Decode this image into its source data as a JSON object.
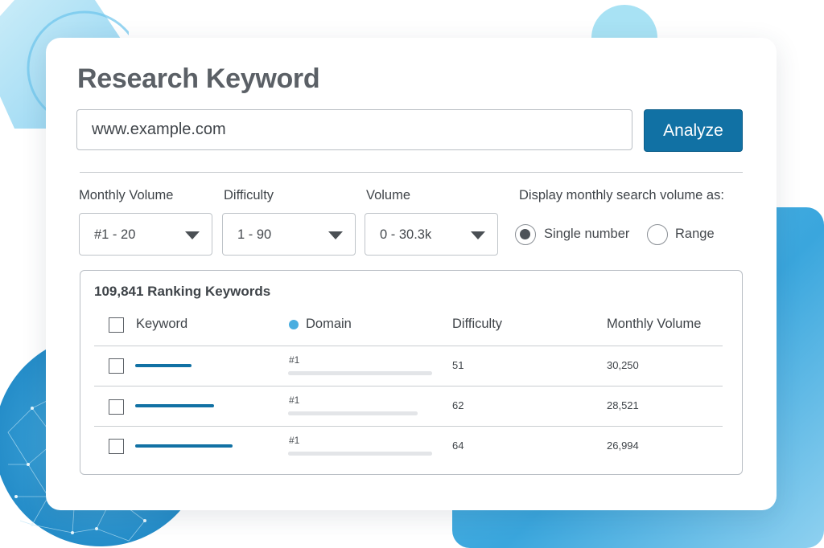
{
  "header": {
    "title": "Research Keyword"
  },
  "search": {
    "value": "www.example.com",
    "analyze_label": "Analyze"
  },
  "filters": [
    {
      "label": "Monthly Volume",
      "value": "#1 - 20"
    },
    {
      "label": "Difficulty",
      "value": "1 - 90"
    },
    {
      "label": "Volume",
      "value": "0 - 30.3k"
    }
  ],
  "display": {
    "label": "Display monthly search volume as:",
    "options": [
      {
        "label": "Single number",
        "selected": true
      },
      {
        "label": "Range",
        "selected": false
      }
    ]
  },
  "results": {
    "title": "109,841 Ranking Keywords",
    "columns": [
      "Keyword",
      "Domain",
      "Difficulty",
      "Monthly Volume"
    ],
    "rows": [
      {
        "rank": "#1",
        "difficulty": "51",
        "volume": "30,250"
      },
      {
        "rank": "#1",
        "difficulty": "62",
        "volume": "28,521"
      },
      {
        "rank": "#1",
        "difficulty": "64",
        "volume": "26,994"
      }
    ]
  },
  "colors": {
    "accent": "#1171a4",
    "domain_dot": "#4aaee0",
    "decor_light": "#a8e2f4",
    "decor_mid": "#4aaee0"
  },
  "icons": [
    "chevron-down-icon",
    "radio-icon",
    "checkbox-icon",
    "dot-icon"
  ]
}
